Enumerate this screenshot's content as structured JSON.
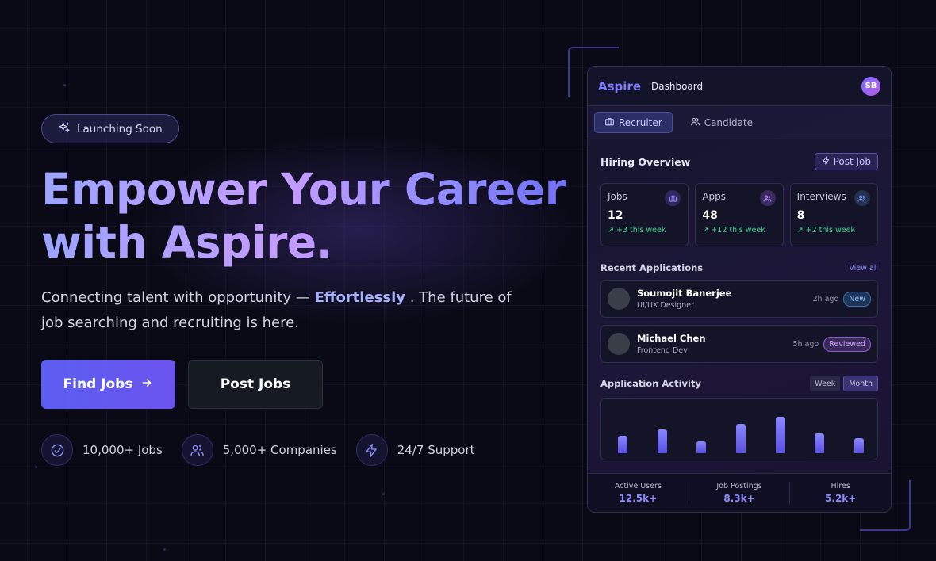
{
  "badge": {
    "label": "Launching Soon",
    "icon": "sparkles-icon"
  },
  "hero": {
    "title_line1": "Empower Your Career",
    "title_line2": "with Aspire.",
    "subtitle_before": "Connecting talent with opportunity —",
    "subtitle_highlight": "Effortlessly",
    "subtitle_after": ". The future of job searching and recruiting is here."
  },
  "buttons": {
    "find_jobs": "Find Jobs",
    "post_jobs": "Post Jobs"
  },
  "stats": [
    {
      "label": "10,000+ Jobs",
      "icon": "check-circle-icon"
    },
    {
      "label": "5,000+ Companies",
      "icon": "users-icon"
    },
    {
      "label": "24/7 Support",
      "icon": "lightning-icon"
    }
  ],
  "dashboard": {
    "brand": "Aspire",
    "nav": "Dashboard",
    "avatar_initials": "SB",
    "tabs": [
      {
        "label": "Recruiter",
        "active": true
      },
      {
        "label": "Candidate",
        "active": false
      }
    ],
    "overview_title": "Hiring Overview",
    "post_job_label": "Post Job",
    "cards": [
      {
        "label": "Jobs",
        "value": "12",
        "trend": "+3 this week"
      },
      {
        "label": "Apps",
        "value": "48",
        "trend": "+12 this week"
      },
      {
        "label": "Interviews",
        "value": "8",
        "trend": "+2 this week"
      }
    ],
    "recent_title": "Recent Applications",
    "view_all": "View all",
    "applications": [
      {
        "name": "Soumojit Banerjee",
        "role": "UI/UX Designer",
        "time": "2h ago",
        "status": "New"
      },
      {
        "name": "Michael Chen",
        "role": "Frontend Dev",
        "time": "5h ago",
        "status": "Reviewed"
      }
    ],
    "activity_title": "Application Activity",
    "activity_periods": [
      {
        "label": "Week",
        "active": false
      },
      {
        "label": "Month",
        "active": true
      }
    ],
    "activity_levels": [
      0.42,
      0.58,
      0.28,
      0.72,
      0.88,
      0.48,
      0.36
    ],
    "footer": [
      {
        "label": "Active Users",
        "value": "12.5k+"
      },
      {
        "label": "Job Postings",
        "value": "8.3k+"
      },
      {
        "label": "Hires",
        "value": "5.2k+"
      }
    ]
  },
  "colors": {
    "accent": "#6c5cf0",
    "success": "#3ed38a",
    "background": "#0a0a16"
  }
}
